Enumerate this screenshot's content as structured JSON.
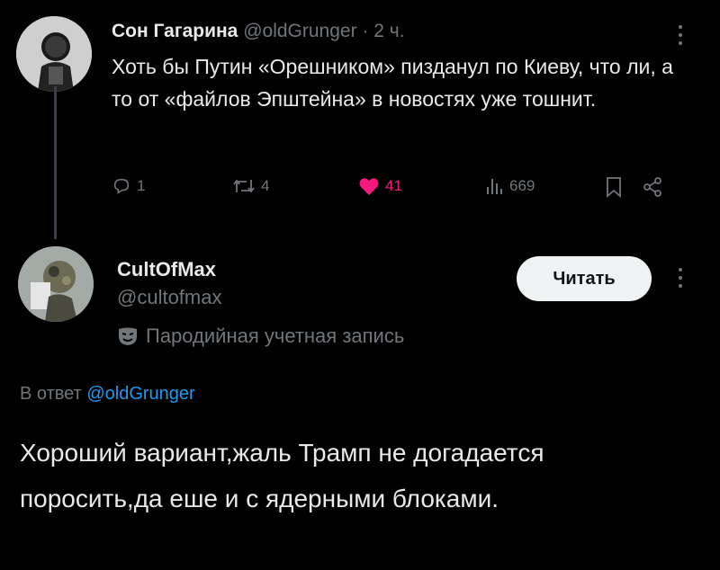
{
  "original_tweet": {
    "author_name": "Сон Гагарина",
    "handle": "@oldGrunger",
    "separator": "·",
    "time": "2 ч.",
    "text": "Хоть бы Путин «Орешником» пизданул по Киеву, что ли, а то от «файлов Эпштейна» в новостях уже тошнит.",
    "replies": "1",
    "retweets": "4",
    "likes": "41",
    "views": "669",
    "like_color": "#f91880"
  },
  "reply_tweet": {
    "author_name": "CultOfMax",
    "handle": "@cultofmax",
    "parody_label": "Пародийная учетная запись",
    "follow_label": "Читать",
    "reply_to_prefix": "В ответ",
    "reply_to_handle": "@oldGrunger",
    "text": "Хороший вариант,жаль Трамп не догадается поросить,да еше и с ядерными блоками."
  },
  "icons": [
    "reply-icon",
    "retweet-icon",
    "like-icon",
    "views-icon",
    "bookmark-icon",
    "share-icon",
    "more-icon",
    "parody-mask-icon"
  ],
  "colors": {
    "background": "#000000",
    "text": "#e7e9ea",
    "muted": "#71767b",
    "link": "#1d9bf0",
    "button_bg": "#eff3f4"
  }
}
